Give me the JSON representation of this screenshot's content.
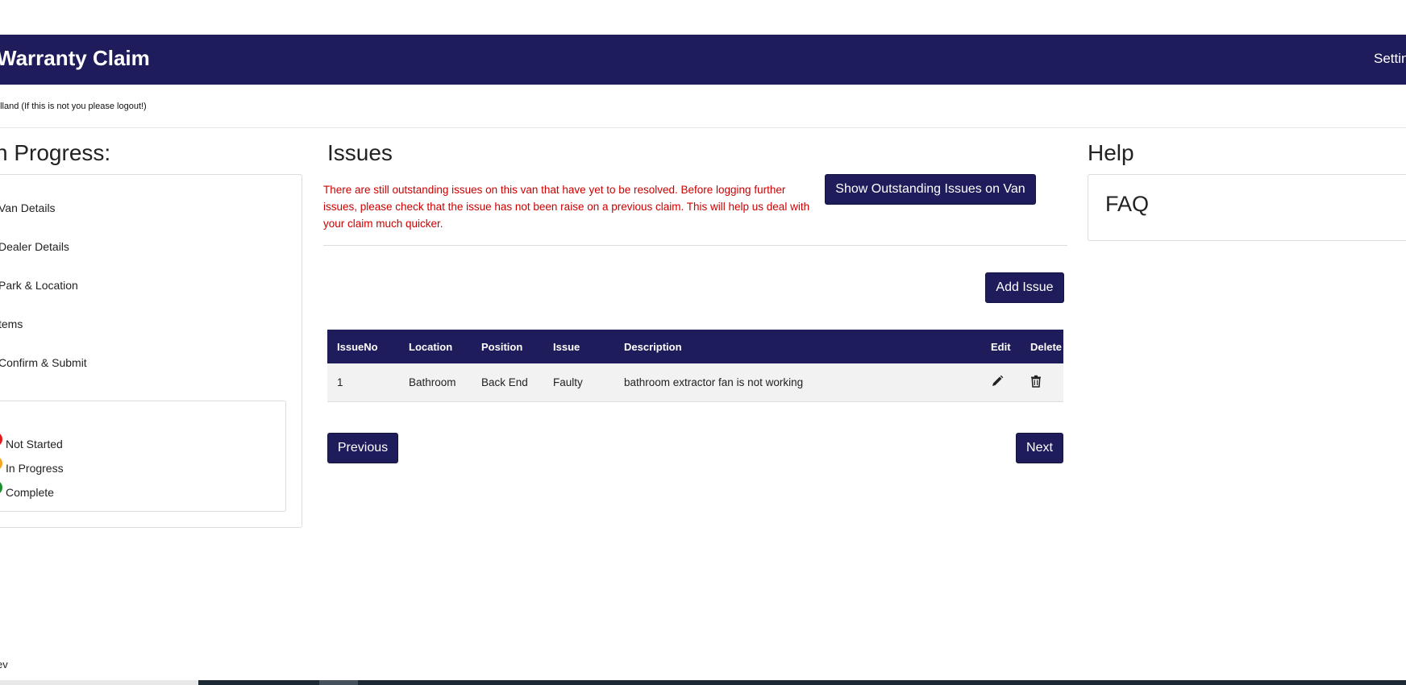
{
  "header": {
    "brand": "Warranty Claim",
    "settings": "Settin"
  },
  "user_line": "olland (If this is not you please logout!)",
  "progress": {
    "title": "n Progress:",
    "steps": [
      "Van Details",
      "Dealer Details",
      "Park & Location",
      "tems",
      "Confirm & Submit"
    ],
    "legend": {
      "key_label": ":",
      "items": [
        {
          "label": "Not Started",
          "color": "#e31b1b"
        },
        {
          "label": "In Progress",
          "color": "#f5a623"
        },
        {
          "label": "Complete",
          "color": "#1a8f2e"
        }
      ]
    }
  },
  "issues": {
    "title": "Issues",
    "warning": "There are still outstanding issues on this van that have yet to be resolved. Before logging further issues, please check that the issue has not been raise on a previous claim. This will help us deal with your claim much quicker.",
    "show_outstanding_label": "Show Outstanding Issues on Van",
    "add_issue_label": "Add Issue",
    "columns": [
      "IssueNo",
      "Location",
      "Position",
      "Issue",
      "Description",
      "Edit",
      "Delete"
    ],
    "rows": [
      {
        "issue_no": "1",
        "location": "Bathroom",
        "position": "Back End",
        "issue": "Faulty",
        "description": "bathroom extractor fan is not working",
        "edit_icon": "pencil-icon",
        "delete_icon": "trash-icon"
      }
    ],
    "previous_label": "Previous",
    "next_label": "Next"
  },
  "help": {
    "title": "Help",
    "faq_label": "FAQ"
  },
  "footer": {
    "text": "ev"
  },
  "colors": {
    "navbar": "#1e1c5a",
    "warning": "#cc0000",
    "button": "#1e1c5a"
  }
}
